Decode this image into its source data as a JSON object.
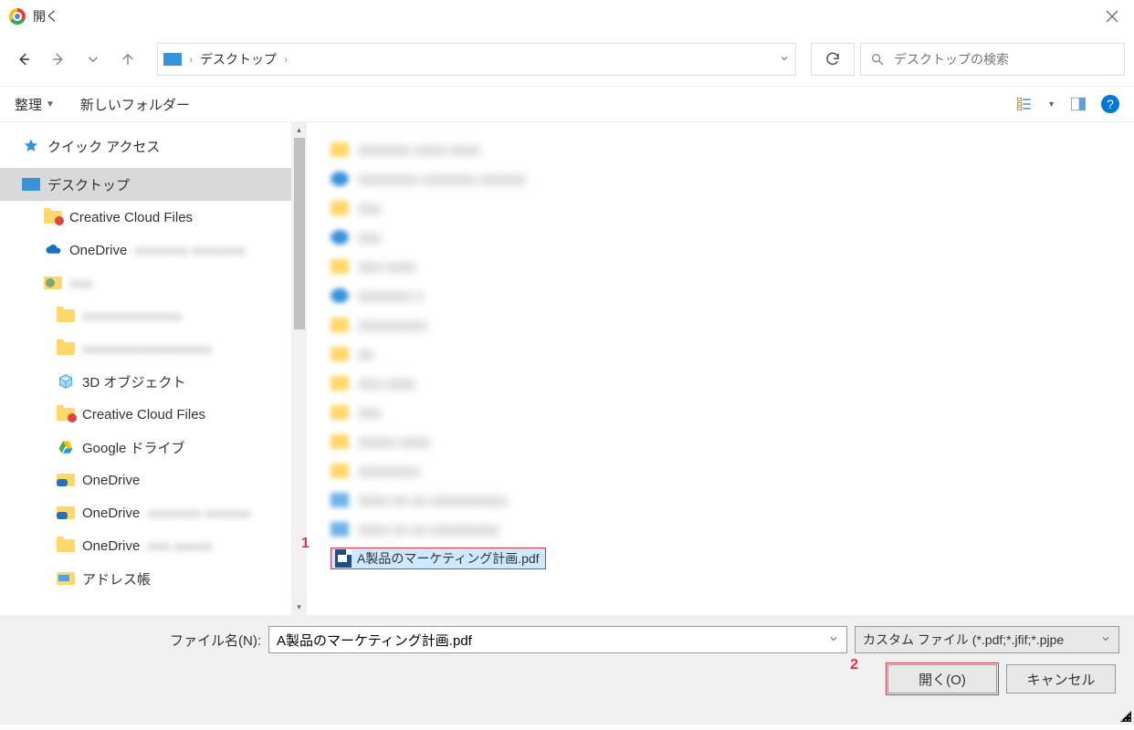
{
  "title": "開く",
  "breadcrumb": {
    "location": "デスクトップ"
  },
  "search": {
    "placeholder": "デスクトップの検索"
  },
  "toolbar": {
    "organize": "整理",
    "newfolder": "新しいフォルダー"
  },
  "sidebar": {
    "quick_access": "クイック アクセス",
    "desktop": "デスクトップ",
    "ccf": "Creative Cloud Files",
    "onedrive": "OneDrive",
    "obj3d": "3D オブジェクト",
    "ccf2": "Creative Cloud Files",
    "gdrive": "Google ドライブ",
    "od1": "OneDrive",
    "od2": "OneDrive",
    "od3": "OneDrive",
    "address": "アドレス帳"
  },
  "file_selected": "A製品のマーケティング計画.pdf",
  "annotations": {
    "a1": "1",
    "a2": "2"
  },
  "footer": {
    "filename_label": "ファイル名(N):",
    "filename_value": "A製品のマーケティング計画.pdf",
    "filter": "カスタム ファイル (*.pdf;*.jfif;*.pjpe",
    "open": "開く(O)",
    "cancel": "キャンセル"
  }
}
